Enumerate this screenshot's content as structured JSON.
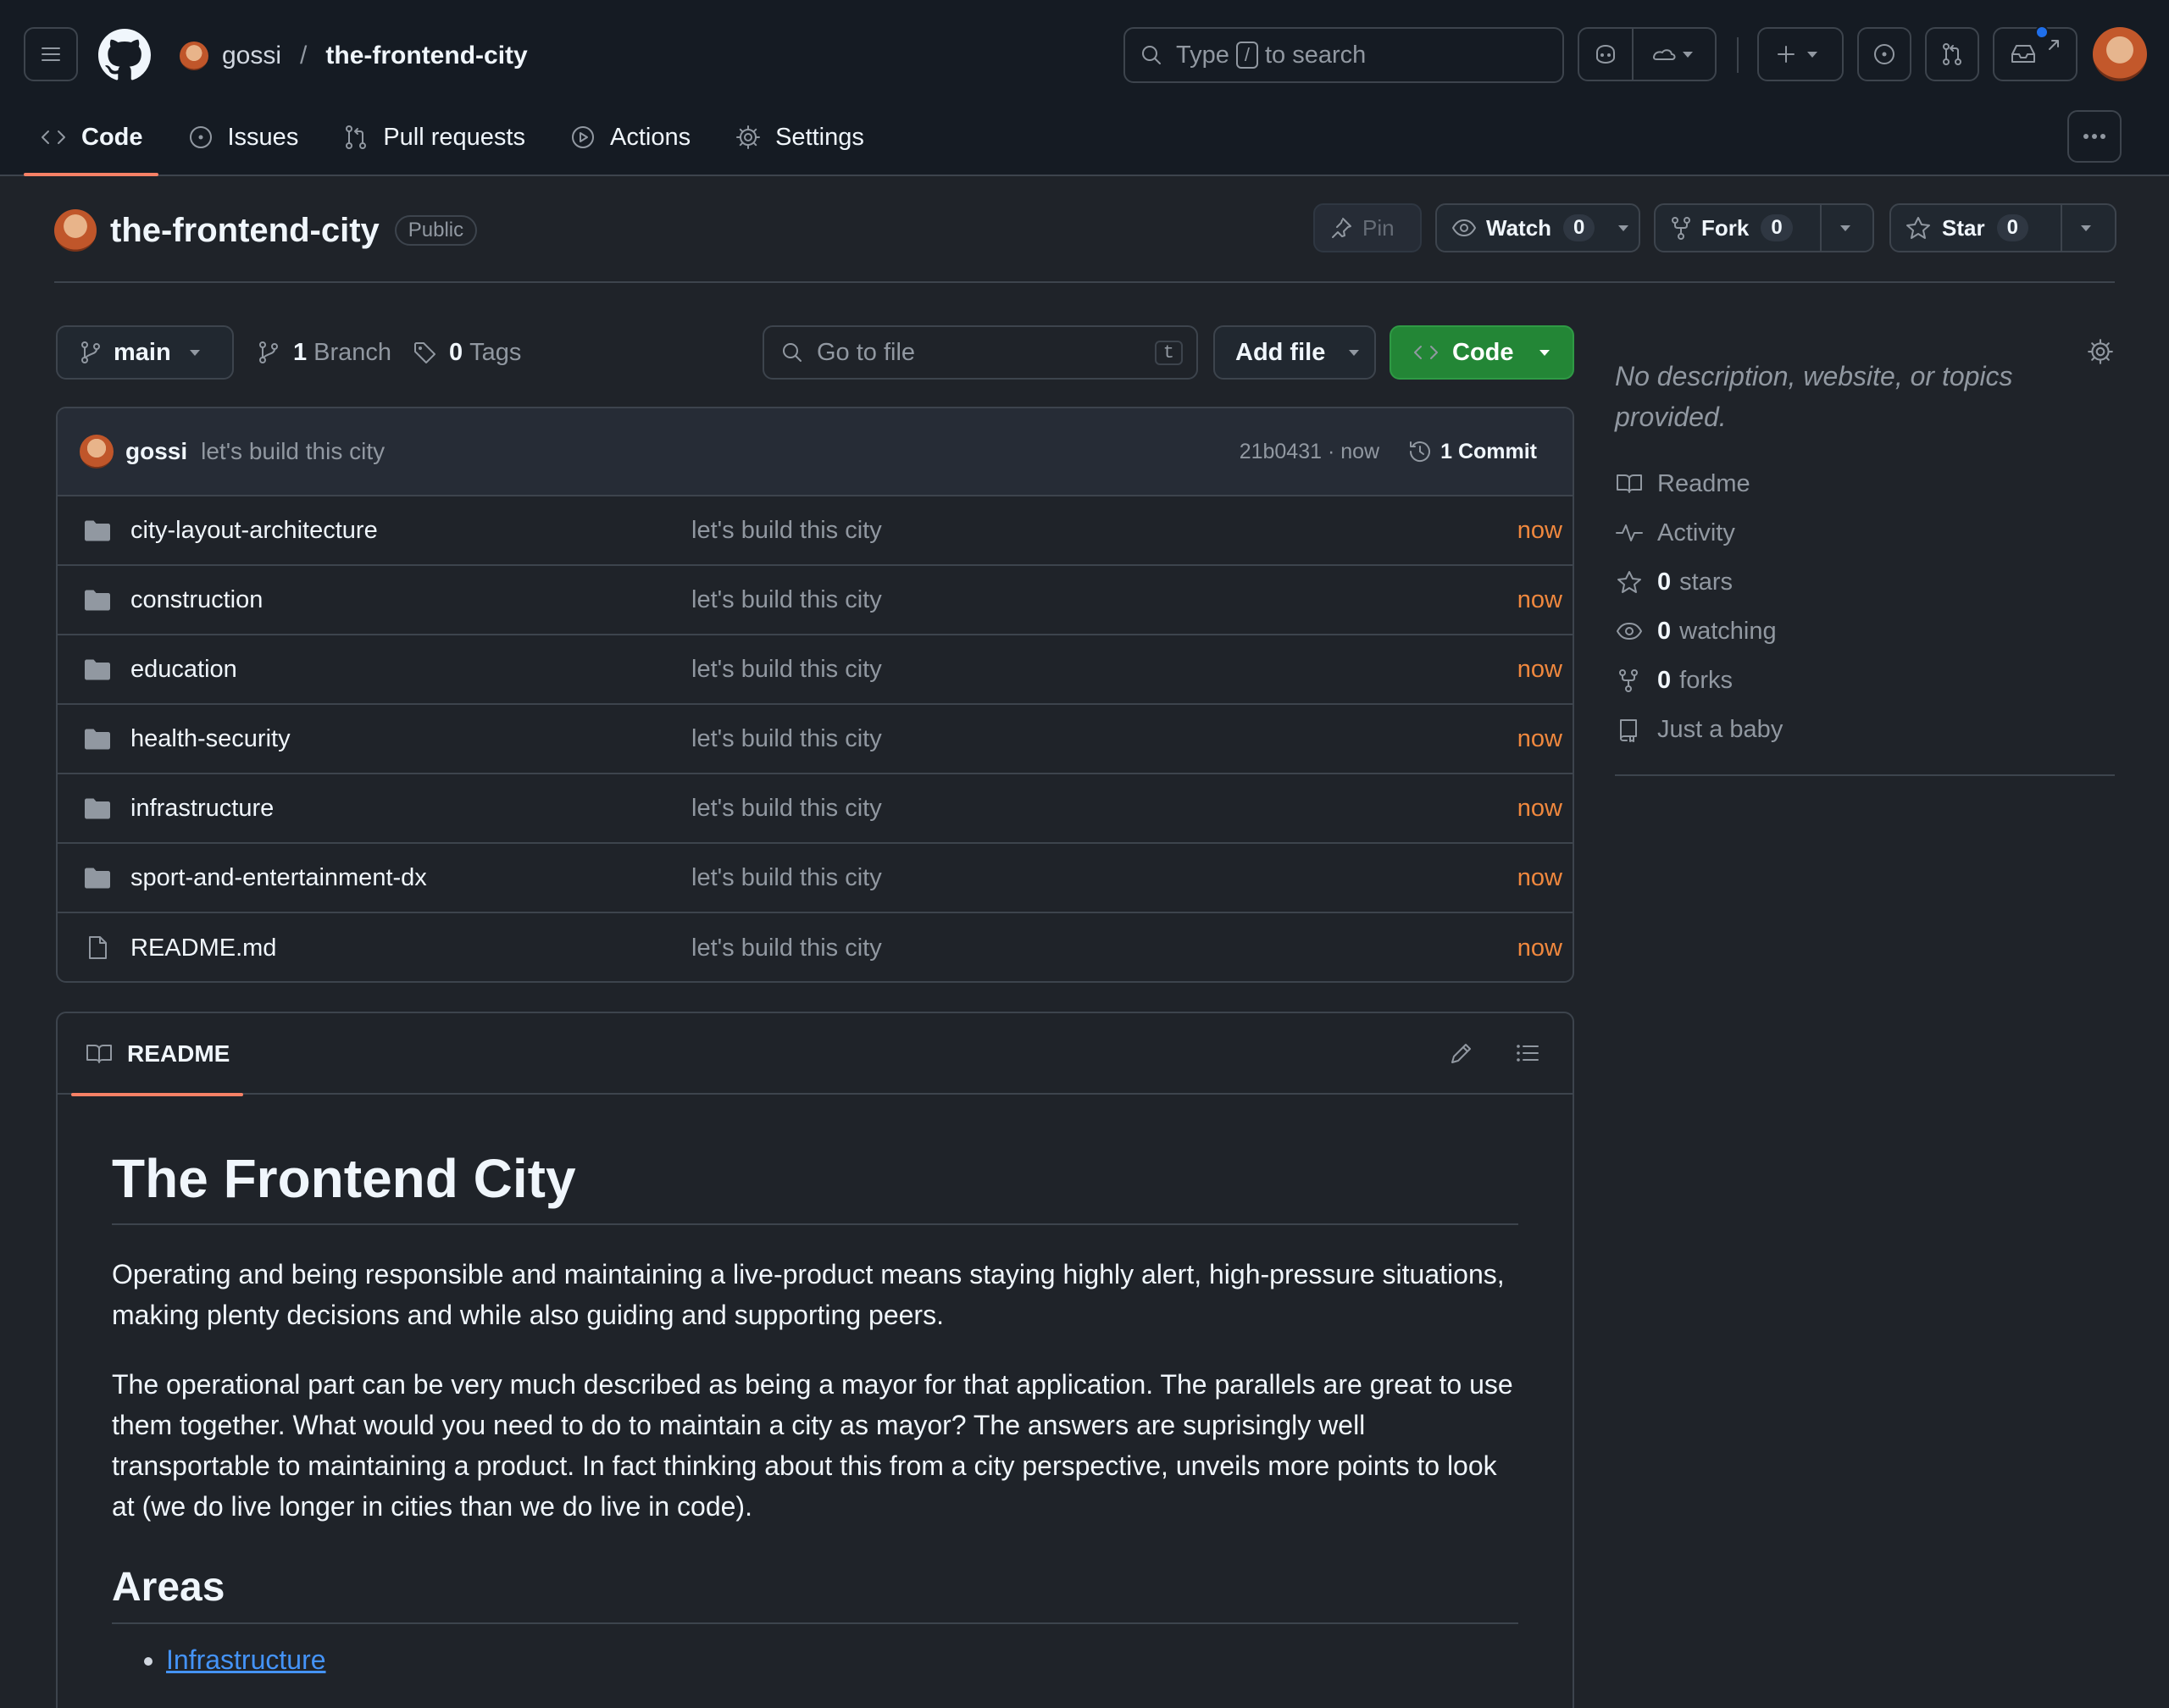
{
  "header": {
    "owner": "gossi",
    "separator": "/",
    "repo": "the-frontend-city",
    "search_prefix": "Type",
    "search_key": "/",
    "search_suffix": "to search"
  },
  "tabs": [
    {
      "label": "Code",
      "active": true
    },
    {
      "label": "Issues"
    },
    {
      "label": "Pull requests"
    },
    {
      "label": "Actions"
    },
    {
      "label": "Settings"
    }
  ],
  "repo_head": {
    "name": "the-frontend-city",
    "visibility": "Public",
    "pin_label": "Pin",
    "watch_label": "Watch",
    "watch_count": "0",
    "fork_label": "Fork",
    "fork_count": "0",
    "star_label": "Star",
    "star_count": "0"
  },
  "file_nav": {
    "branch": "main",
    "branch_count": "1",
    "branch_label": "Branch",
    "tag_count": "0",
    "tag_label": "Tags",
    "go_to_file_placeholder": "Go to file",
    "go_to_file_key": "t",
    "add_file_label": "Add file",
    "code_label": "Code"
  },
  "latest_commit": {
    "author": "gossi",
    "message": "let's build this city",
    "hash_time": "21b0431 · now",
    "commit_count": "1 Commit"
  },
  "files": [
    {
      "type": "folder",
      "name": "city-layout-architecture",
      "message": "let's build this city",
      "time": "now"
    },
    {
      "type": "folder",
      "name": "construction",
      "message": "let's build this city",
      "time": "now"
    },
    {
      "type": "folder",
      "name": "education",
      "message": "let's build this city",
      "time": "now"
    },
    {
      "type": "folder",
      "name": "health-security",
      "message": "let's build this city",
      "time": "now"
    },
    {
      "type": "folder",
      "name": "infrastructure",
      "message": "let's build this city",
      "time": "now"
    },
    {
      "type": "folder",
      "name": "sport-and-entertainment-dx",
      "message": "let's build this city",
      "time": "now"
    },
    {
      "type": "file",
      "name": "README.md",
      "message": "let's build this city",
      "time": "now"
    }
  ],
  "readme": {
    "tab_label": "README",
    "title": "The Frontend City",
    "paragraphs": [
      "Operating and being responsible and maintaining a live-product means staying highly alert, high-pressure situations, making plenty decisions and while also guiding and supporting peers.",
      "The operational part can be very much described as being a mayor for that application. The parallels are great to use them together. What would you need to do to maintain a city as mayor? The answers are suprisingly well transportable to maintaining a product. In fact thinking about this from a city perspective, unveils more points to look at (we do live longer in cities than we do live in code)."
    ],
    "areas_heading": "Areas",
    "areas": [
      "Infrastructure"
    ]
  },
  "about": {
    "description": "No description, website, or topics provided.",
    "readme": "Readme",
    "activity": "Activity",
    "stars_count": "0",
    "stars_label": "stars",
    "watching_count": "0",
    "watching_label": "watching",
    "forks_count": "0",
    "forks_label": "forks",
    "custom_property": "Just a baby"
  },
  "colors": {
    "accent_green": "#238636",
    "tab_underline": "#f78166",
    "time_orange": "#f0883e",
    "link_blue": "#4493f8",
    "notification_dot": "#1f6feb"
  }
}
